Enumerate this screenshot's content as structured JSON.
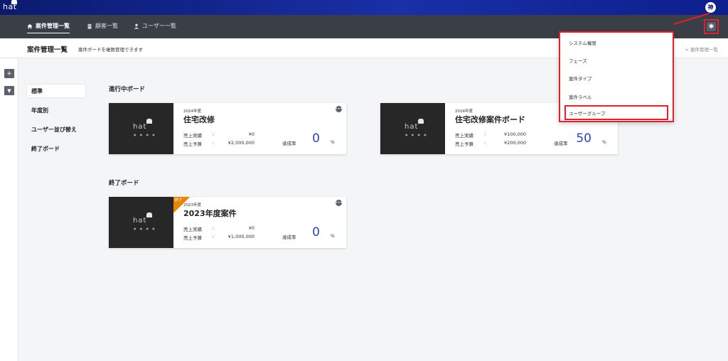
{
  "app": {
    "logo": "hat",
    "user_avatar": "神"
  },
  "nav": {
    "items": [
      {
        "label": "案件管理一覧",
        "icon": "home-icon",
        "active": true
      },
      {
        "label": "顧客一覧",
        "icon": "building-icon",
        "active": false
      },
      {
        "label": "ユーザー一覧",
        "icon": "user-icon",
        "active": false
      }
    ],
    "settings_icon": "gear-icon"
  },
  "subheader": {
    "title": "案件管理一覧",
    "description": "案件ボードを複数管理できます",
    "breadcrumb": "> 案件管理一覧"
  },
  "rail": {
    "add_icon": "+",
    "filter_icon": "▼"
  },
  "menu": {
    "items": [
      {
        "label": "標準",
        "active": true
      },
      {
        "label": "年度別",
        "active": false
      },
      {
        "label": "ユーザー並び替え",
        "active": false
      },
      {
        "label": "終了ボード",
        "active": false
      }
    ]
  },
  "sections": {
    "active_title": "進行中ボード",
    "ended_title": "終了ボード"
  },
  "cards": [
    {
      "year": "2024年度",
      "name": "住宅改修",
      "actual_label": "売上実績",
      "actual_value": "¥0",
      "budget_label": "売上予算",
      "budget_value": "¥2,000,000",
      "rate_label": "達成率",
      "rate_value": "0",
      "rate_unit": "%"
    },
    {
      "year": "2024年度",
      "name": "住宅改修案件ボード",
      "actual_label": "売上実績",
      "actual_value": "¥100,000",
      "budget_label": "売上予算",
      "budget_value": "¥200,000",
      "rate_label": "達成率",
      "rate_value": "50",
      "rate_unit": "%"
    },
    {
      "year": "2023年度",
      "name": "2023年度案件",
      "actual_label": "売上実績",
      "actual_value": "¥0",
      "budget_label": "売上予算",
      "budget_value": "¥1,000,000",
      "rate_label": "達成率",
      "rate_value": "0",
      "rate_unit": "%",
      "badge": "終了"
    }
  ],
  "card_common": {
    "colon": ":",
    "more": "•••",
    "thumb_logo": "hat",
    "thumb_dots": "● ● ● ●"
  },
  "dropdown": {
    "items": [
      {
        "label": "システム権限"
      },
      {
        "label": "フェーズ"
      },
      {
        "label": "案件タイプ"
      },
      {
        "label": "案件ラベル"
      },
      {
        "label": "ユーザーグループ",
        "highlighted": true
      }
    ]
  },
  "colors": {
    "topbar": "#0b1a6e",
    "navbar": "#3a3f47",
    "accent_red": "#e0202a",
    "rate_blue": "#2b44b8",
    "badge_orange": "#e8860b"
  }
}
